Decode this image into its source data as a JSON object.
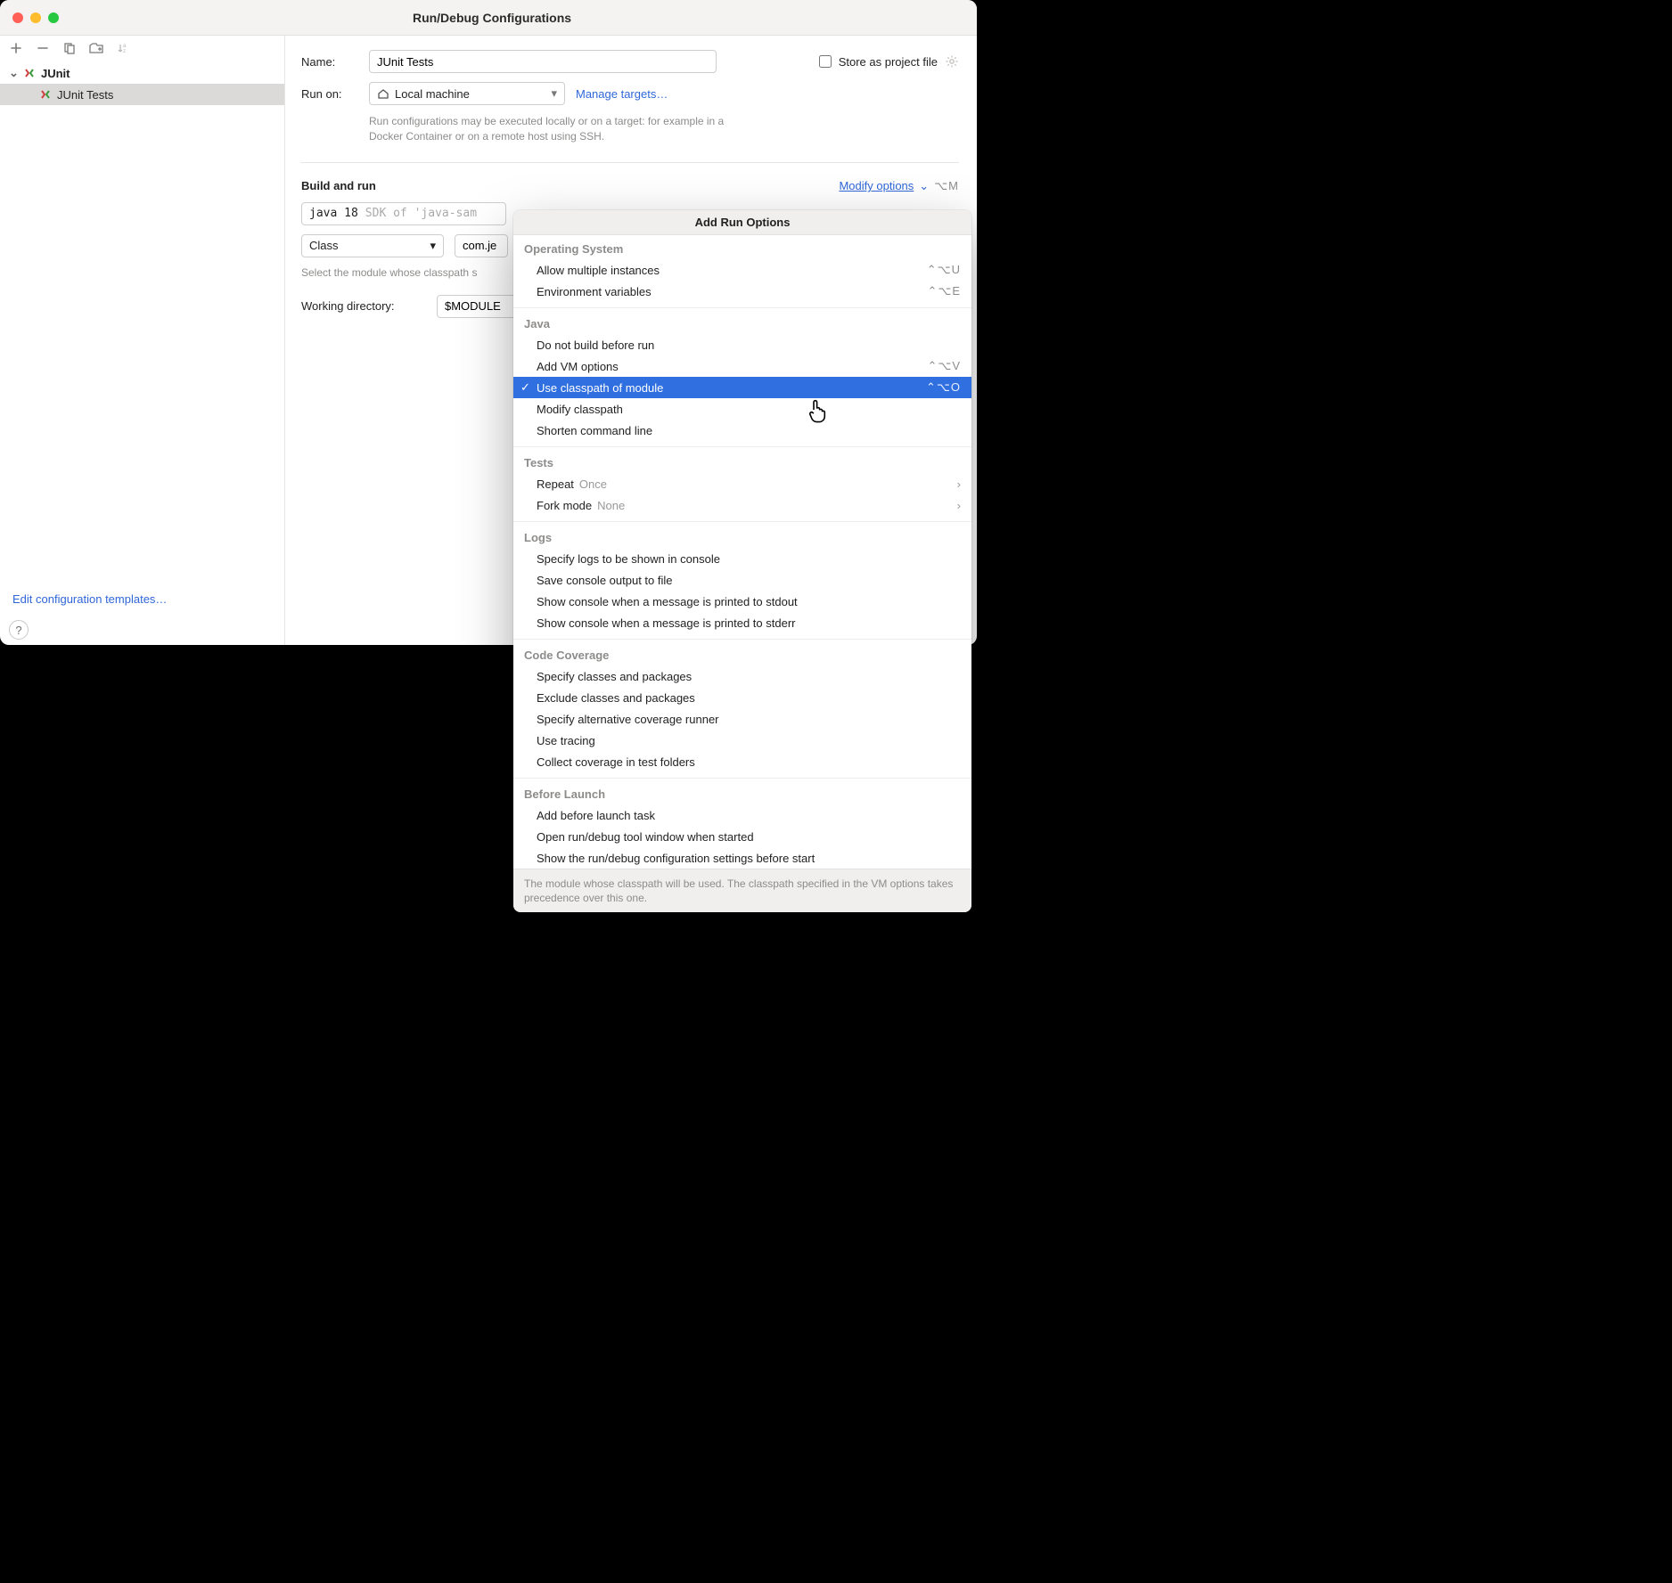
{
  "window": {
    "title": "Run/Debug Configurations"
  },
  "sidebar": {
    "root_label": "JUnit",
    "items": [
      {
        "label": "JUnit Tests"
      }
    ],
    "edit_templates_label": "Edit configuration templates…"
  },
  "form": {
    "name_label": "Name:",
    "name_value": "JUnit Tests",
    "store_label": "Store as project file",
    "run_on_label": "Run on:",
    "run_on_value": "Local machine",
    "manage_targets_label": "Manage targets…",
    "run_on_hint": "Run configurations may be executed locally or on a target: for example in a Docker Container or on a remote host using SSH.",
    "build_section": "Build and run",
    "modify_options_label": "Modify options",
    "modify_options_shortcut": "⌥M",
    "sdk_strong": "java 18",
    "sdk_dim": " SDK of 'java-sam",
    "class_mode": "Class",
    "class_value": "com.je",
    "classpath_caption": "Select the module whose classpath s",
    "wd_label": "Working directory:",
    "wd_value": "$MODULE"
  },
  "popup": {
    "title": "Add Run Options",
    "footer": "The module whose classpath will be used. The classpath specified in the VM options takes precedence over this one.",
    "groups": [
      {
        "title": "Operating System",
        "items": [
          {
            "label": "Allow multiple instances",
            "shortcut": "⌃⌥U"
          },
          {
            "label": "Environment variables",
            "shortcut": "⌃⌥E"
          }
        ]
      },
      {
        "title": "Java",
        "items": [
          {
            "label": "Do not build before run"
          },
          {
            "label": "Add VM options",
            "shortcut": "⌃⌥V"
          },
          {
            "label": "Use classpath of module",
            "shortcut": "⌃⌥O",
            "selected": true
          },
          {
            "label": "Modify classpath"
          },
          {
            "label": "Shorten command line"
          }
        ]
      },
      {
        "title": "Tests",
        "items": [
          {
            "label": "Repeat",
            "value": "Once",
            "submenu": true
          },
          {
            "label": "Fork mode",
            "value": "None",
            "submenu": true
          }
        ]
      },
      {
        "title": "Logs",
        "items": [
          {
            "label": "Specify logs to be shown in console"
          },
          {
            "label": "Save console output to file"
          },
          {
            "label": "Show console when a message is printed to stdout"
          },
          {
            "label": "Show console when a message is printed to stderr"
          }
        ]
      },
      {
        "title": "Code Coverage",
        "items": [
          {
            "label": "Specify classes and packages"
          },
          {
            "label": "Exclude classes and packages"
          },
          {
            "label": "Specify alternative coverage runner"
          },
          {
            "label": "Use tracing"
          },
          {
            "label": "Collect coverage in test folders"
          }
        ]
      },
      {
        "title": "Before Launch",
        "items": [
          {
            "label": "Add before launch task"
          },
          {
            "label": "Open run/debug tool window when started"
          },
          {
            "label": "Show the run/debug configuration settings before start"
          }
        ]
      }
    ]
  }
}
